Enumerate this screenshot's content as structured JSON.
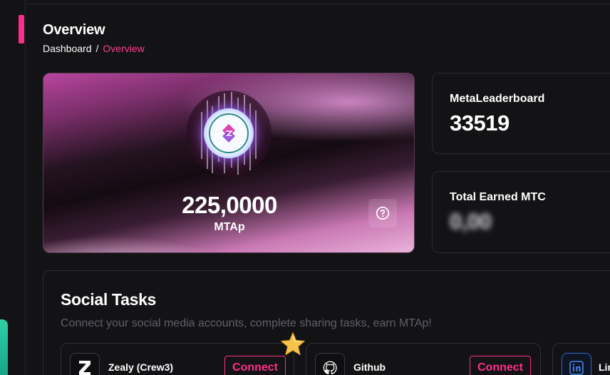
{
  "header": {
    "title": "Overview",
    "breadcrumbs": [
      {
        "label": "Dashboard"
      },
      {
        "label": "Overview"
      }
    ],
    "breadcrumb_separator": "/"
  },
  "balance": {
    "value": "225,0000",
    "unit": "MTAp",
    "help_icon": "help-circle-icon"
  },
  "stats": [
    {
      "label": "MetaLeaderboard",
      "value": "33519"
    },
    {
      "label": "Total Earned MTC",
      "value": "0,00"
    }
  ],
  "social_tasks": {
    "title": "Social Tasks",
    "subtitle": "Connect your social media accounts, complete sharing tasks, earn MTAp!",
    "tasks": [
      {
        "name": "Zealy (Crew3)",
        "icon": "zealy-icon",
        "button": "Connect"
      },
      {
        "name": "Github",
        "icon": "github-icon",
        "button": "Connect"
      },
      {
        "name": "Lin",
        "icon": "linkedin-icon"
      }
    ]
  },
  "colors": {
    "accent": "#ff2d8a",
    "background": "#131316",
    "card_border": "#2b2b31",
    "muted_text": "#5f5f6b"
  }
}
